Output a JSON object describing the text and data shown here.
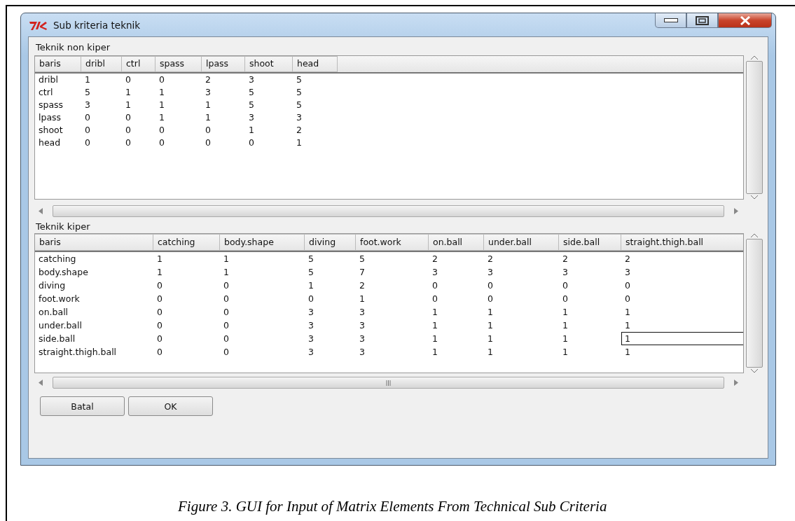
{
  "window": {
    "title": "Sub kriteria teknik"
  },
  "sections": [
    {
      "label": "Teknik non kiper",
      "columns": [
        "baris",
        "dribl",
        "ctrl",
        "spass",
        "lpass",
        "shoot",
        "head"
      ],
      "rows": [
        {
          "cells": [
            {
              "text": "dribl",
              "focused": false
            },
            {
              "text": "1",
              "focused": false
            },
            {
              "text": "0",
              "focused": false
            },
            {
              "text": "0",
              "focused": false
            },
            {
              "text": "2",
              "focused": false
            },
            {
              "text": "3",
              "focused": false
            },
            {
              "text": "5",
              "focused": false
            }
          ]
        },
        {
          "cells": [
            {
              "text": "ctrl",
              "focused": false
            },
            {
              "text": "5",
              "focused": false
            },
            {
              "text": "1",
              "focused": false
            },
            {
              "text": "1",
              "focused": false
            },
            {
              "text": "3",
              "focused": false
            },
            {
              "text": "5",
              "focused": false
            },
            {
              "text": "5",
              "focused": false
            }
          ]
        },
        {
          "cells": [
            {
              "text": "spass",
              "focused": false
            },
            {
              "text": "3",
              "focused": false
            },
            {
              "text": "1",
              "focused": false
            },
            {
              "text": "1",
              "focused": false
            },
            {
              "text": "1",
              "focused": false
            },
            {
              "text": "5",
              "focused": false
            },
            {
              "text": "5",
              "focused": false
            }
          ]
        },
        {
          "cells": [
            {
              "text": "lpass",
              "focused": false
            },
            {
              "text": "0",
              "focused": false
            },
            {
              "text": "0",
              "focused": false
            },
            {
              "text": "1",
              "focused": false
            },
            {
              "text": "1",
              "focused": false
            },
            {
              "text": "3",
              "focused": false
            },
            {
              "text": "3",
              "focused": false
            }
          ]
        },
        {
          "cells": [
            {
              "text": "shoot",
              "focused": false
            },
            {
              "text": "0",
              "focused": false
            },
            {
              "text": "0",
              "focused": false
            },
            {
              "text": "0",
              "focused": false
            },
            {
              "text": "0",
              "focused": false
            },
            {
              "text": "1",
              "focused": false
            },
            {
              "text": "2",
              "focused": false
            }
          ]
        },
        {
          "cells": [
            {
              "text": "head",
              "focused": false
            },
            {
              "text": "0",
              "focused": false
            },
            {
              "text": "0",
              "focused": false
            },
            {
              "text": "0",
              "focused": false
            },
            {
              "text": "0",
              "focused": false
            },
            {
              "text": "0",
              "focused": false
            },
            {
              "text": "1",
              "focused": false
            }
          ]
        }
      ]
    },
    {
      "label": "Teknik kiper",
      "columns": [
        "baris",
        "catching",
        "body.shape",
        "diving",
        "foot.work",
        "on.ball",
        "under.ball",
        "side.ball",
        "straight.thigh.ball"
      ],
      "rows": [
        {
          "cells": [
            {
              "text": "catching",
              "focused": false
            },
            {
              "text": "1",
              "focused": false
            },
            {
              "text": "1",
              "focused": false
            },
            {
              "text": "5",
              "focused": false
            },
            {
              "text": "5",
              "focused": false
            },
            {
              "text": "2",
              "focused": false
            },
            {
              "text": "2",
              "focused": false
            },
            {
              "text": "2",
              "focused": false
            },
            {
              "text": "2",
              "focused": false
            }
          ]
        },
        {
          "cells": [
            {
              "text": "body.shape",
              "focused": false
            },
            {
              "text": "1",
              "focused": false
            },
            {
              "text": "1",
              "focused": false
            },
            {
              "text": "5",
              "focused": false
            },
            {
              "text": "7",
              "focused": false
            },
            {
              "text": "3",
              "focused": false
            },
            {
              "text": "3",
              "focused": false
            },
            {
              "text": "3",
              "focused": false
            },
            {
              "text": "3",
              "focused": false
            }
          ]
        },
        {
          "cells": [
            {
              "text": "diving",
              "focused": false
            },
            {
              "text": "0",
              "focused": false
            },
            {
              "text": "0",
              "focused": false
            },
            {
              "text": "1",
              "focused": false
            },
            {
              "text": "2",
              "focused": false
            },
            {
              "text": "0",
              "focused": false
            },
            {
              "text": "0",
              "focused": false
            },
            {
              "text": "0",
              "focused": false
            },
            {
              "text": "0",
              "focused": false
            }
          ]
        },
        {
          "cells": [
            {
              "text": "foot.work",
              "focused": false
            },
            {
              "text": "0",
              "focused": false
            },
            {
              "text": "0",
              "focused": false
            },
            {
              "text": "0",
              "focused": false
            },
            {
              "text": "1",
              "focused": false
            },
            {
              "text": "0",
              "focused": false
            },
            {
              "text": "0",
              "focused": false
            },
            {
              "text": "0",
              "focused": false
            },
            {
              "text": "0",
              "focused": false
            }
          ]
        },
        {
          "cells": [
            {
              "text": "on.ball",
              "focused": false
            },
            {
              "text": "0",
              "focused": false
            },
            {
              "text": "0",
              "focused": false
            },
            {
              "text": "3",
              "focused": false
            },
            {
              "text": "3",
              "focused": false
            },
            {
              "text": "1",
              "focused": false
            },
            {
              "text": "1",
              "focused": false
            },
            {
              "text": "1",
              "focused": false
            },
            {
              "text": "1",
              "focused": false
            }
          ]
        },
        {
          "cells": [
            {
              "text": "under.ball",
              "focused": false
            },
            {
              "text": "0",
              "focused": false
            },
            {
              "text": "0",
              "focused": false
            },
            {
              "text": "3",
              "focused": false
            },
            {
              "text": "3",
              "focused": false
            },
            {
              "text": "1",
              "focused": false
            },
            {
              "text": "1",
              "focused": false
            },
            {
              "text": "1",
              "focused": false
            },
            {
              "text": "1",
              "focused": false
            }
          ]
        },
        {
          "cells": [
            {
              "text": "side.ball",
              "focused": false
            },
            {
              "text": "0",
              "focused": false
            },
            {
              "text": "0",
              "focused": false
            },
            {
              "text": "3",
              "focused": false
            },
            {
              "text": "3",
              "focused": false
            },
            {
              "text": "1",
              "focused": false
            },
            {
              "text": "1",
              "focused": false
            },
            {
              "text": "1",
              "focused": false
            },
            {
              "text": "1",
              "focused": true
            }
          ]
        },
        {
          "cells": [
            {
              "text": "straight.thigh.ball",
              "focused": false
            },
            {
              "text": "0",
              "focused": false
            },
            {
              "text": "0",
              "focused": false
            },
            {
              "text": "3",
              "focused": false
            },
            {
              "text": "3",
              "focused": false
            },
            {
              "text": "1",
              "focused": false
            },
            {
              "text": "1",
              "focused": false
            },
            {
              "text": "1",
              "focused": false
            },
            {
              "text": "1",
              "focused": false
            }
          ]
        }
      ]
    }
  ],
  "buttons": [
    "Batal",
    "OK"
  ],
  "caption": "Figure 3. GUI for Input of Matrix Elements From Technical Sub Criteria"
}
